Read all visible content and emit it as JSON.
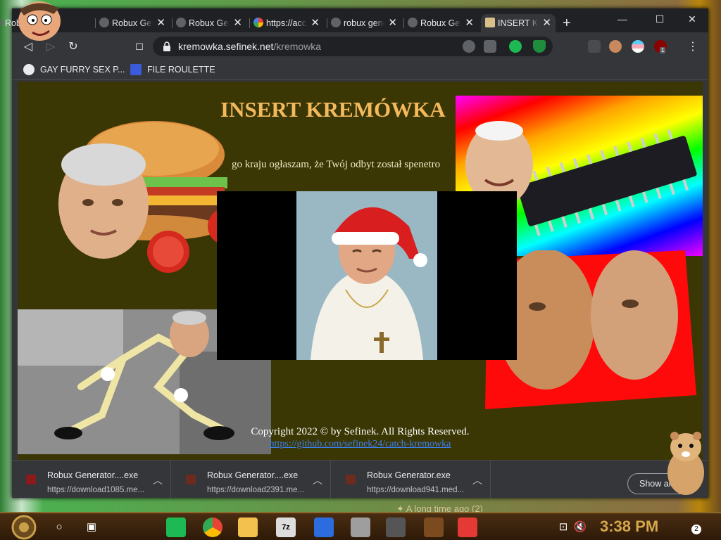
{
  "browser": {
    "tabs": [
      {
        "label": "Robux Generator",
        "icon": "globe-icon",
        "close": "✕"
      },
      {
        "label": "Robux Generator",
        "icon": "globe-icon",
        "close": "✕"
      },
      {
        "label": "Robux Generator",
        "icon": "globe-icon",
        "close": "✕"
      },
      {
        "label": "https://accounts",
        "icon": "google-icon",
        "close": "✕"
      },
      {
        "label": "robux generator",
        "icon": "globe-icon",
        "close": "✕"
      },
      {
        "label": "Robux Generator",
        "icon": "globe-icon",
        "close": "✕"
      },
      {
        "label": "INSERT KREMÓWKA",
        "icon": "kremowka-icon",
        "close": "✕",
        "active": true
      }
    ],
    "new_tab": "+",
    "window_controls": {
      "minimize": "—",
      "maximize": "☐",
      "close": "✕"
    },
    "nav": {
      "back": "◁",
      "forward": "▷",
      "reload": "↻",
      "bookmark": "☐"
    },
    "address": {
      "host": "kremowka.sefinek.net",
      "path": "/kremowka",
      "lock_icon": "lock-icon"
    },
    "menu_icon": "⋮",
    "bookmarks": [
      {
        "label": "GAY FURRY SEX P...",
        "icon": "globe-icon"
      },
      {
        "label": "FILE ROULETTE",
        "icon": "mf-icon"
      }
    ],
    "extension_badge": "1"
  },
  "page": {
    "title": "INSERT KREMÓWKA",
    "body_text": "go kraju ogłaszam, że Twój odbyt został spenetro",
    "copyright": "Copyright 2022 © by Sefinek. All Rights Reserved.",
    "link": "https://github.com/sefinek24/catch-kremowka"
  },
  "downloads": {
    "items": [
      {
        "name": "Robux Generator....exe",
        "url": "https://download1085.me..."
      },
      {
        "name": "Robux Generator....exe",
        "url": "https://download2391.me..."
      },
      {
        "name": "Robux Generator.exe",
        "url": "https://download941.med..."
      }
    ],
    "show_all": "Show all"
  },
  "desktop": {
    "behind_text": "✦ A long time ago (2)",
    "clock": "3:38 PM",
    "notification_count": "2"
  },
  "colors": {
    "page_bg": "#3b3704",
    "title": "#f4b95d",
    "link": "#3b82f6",
    "tab_strip": "#202124",
    "toolbar": "#35363a"
  }
}
